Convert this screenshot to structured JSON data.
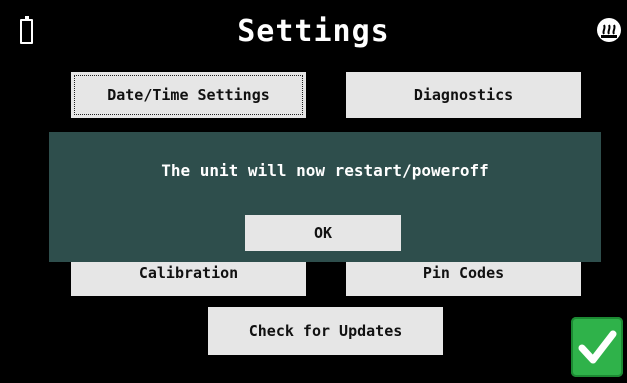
{
  "header": {
    "title": "Settings",
    "left_icon": "battery-icon",
    "right_icon": "heat-icon"
  },
  "menu": {
    "date_time_label": "Date/Time Settings",
    "diagnostics_label": "Diagnostics",
    "calibration_label": "Calibration",
    "pin_codes_label": "Pin Codes",
    "check_updates_label": "Check for Updates"
  },
  "dialog": {
    "message": "The unit will now restart/poweroff",
    "ok_label": "OK"
  },
  "confirm": {
    "icon": "checkmark-icon"
  },
  "colors": {
    "background": "#000000",
    "button": "#e6e6e6",
    "dialog": "#2e4e4c",
    "confirm": "#2fb24a"
  }
}
